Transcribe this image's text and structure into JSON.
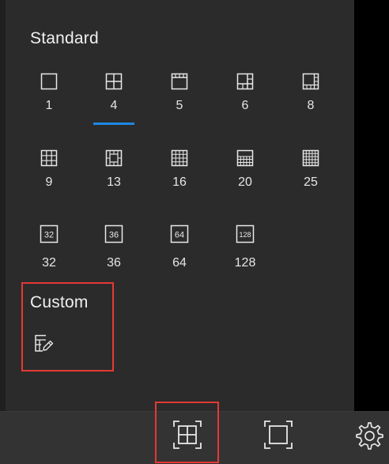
{
  "panel": {
    "standard_title": "Standard",
    "custom_title": "Custom",
    "layouts": [
      {
        "label": "1",
        "icon": "layout-1-icon"
      },
      {
        "label": "4",
        "icon": "layout-4-icon",
        "selected": true
      },
      {
        "label": "5",
        "icon": "layout-5-icon"
      },
      {
        "label": "6",
        "icon": "layout-6-icon"
      },
      {
        "label": "8",
        "icon": "layout-8-icon"
      },
      {
        "label": "9",
        "icon": "layout-9-icon"
      },
      {
        "label": "13",
        "icon": "layout-13-icon"
      },
      {
        "label": "16",
        "icon": "layout-16-icon"
      },
      {
        "label": "20",
        "icon": "layout-20-icon"
      },
      {
        "label": "25",
        "icon": "layout-25-icon"
      },
      {
        "label": "32",
        "icon": "layout-32-icon",
        "badge": "32"
      },
      {
        "label": "36",
        "icon": "layout-36-icon",
        "badge": "36"
      },
      {
        "label": "64",
        "icon": "layout-64-icon",
        "badge": "64"
      },
      {
        "label": "128",
        "icon": "layout-128-icon",
        "badge": "128"
      }
    ]
  },
  "colors": {
    "accent": "#1e88e5",
    "highlight": "#e53935",
    "panel_bg": "#2b2b2b",
    "bar_bg": "#333333"
  },
  "bottom_bar": {
    "buttons": [
      "window-layout-icon",
      "fullscreen-icon",
      "settings-gear-icon"
    ]
  }
}
